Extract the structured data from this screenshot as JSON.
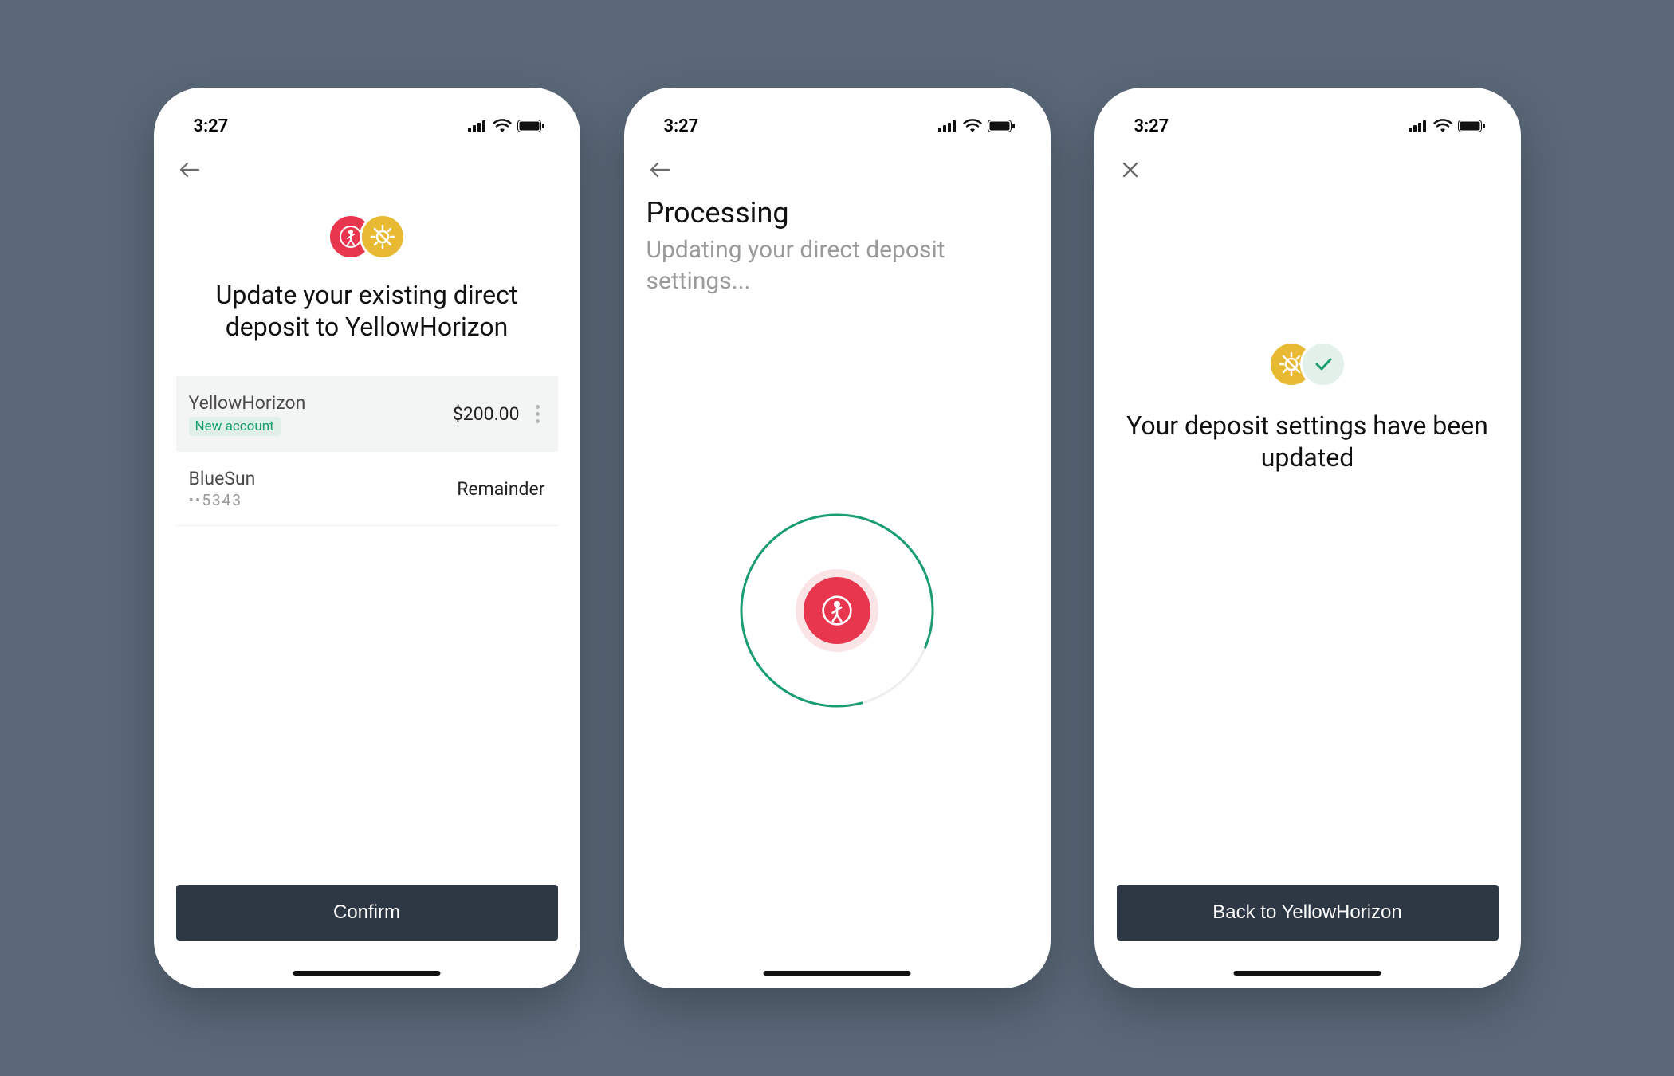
{
  "status": {
    "time": "3:27"
  },
  "colors": {
    "red": "#e8364f",
    "yellow": "#e8b933",
    "green": "#1a9e6f",
    "button": "#2e3845"
  },
  "screen1": {
    "headline": "Update your existing direct deposit to YellowHorizon",
    "accounts": [
      {
        "name": "YellowHorizon",
        "badge": "New account",
        "amount": "$200.00",
        "highlight": true,
        "hasMenu": true
      },
      {
        "name": "BlueSun",
        "sub": "••5343",
        "amount": "Remainder",
        "highlight": false,
        "hasMenu": false
      }
    ],
    "confirm_label": "Confirm"
  },
  "screen2": {
    "title": "Processing",
    "subtitle": "Updating your direct deposit settings..."
  },
  "screen3": {
    "headline": "Your deposit settings have been updated",
    "back_label": "Back to YellowHorizon"
  }
}
